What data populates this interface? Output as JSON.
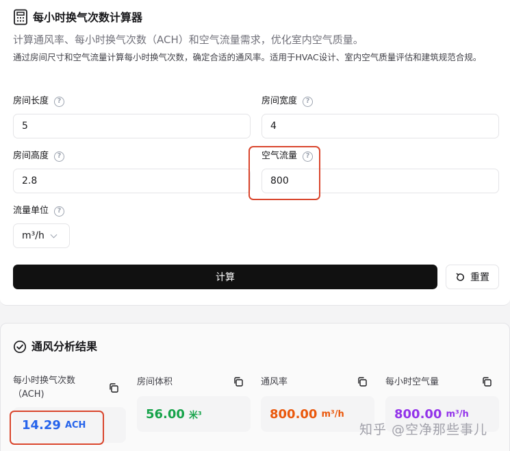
{
  "header": {
    "title": "每小时换气次数计算器",
    "subtitle": "计算通风率、每小时换气次数（ACH）和空气流量需求，优化室内空气质量。",
    "description": "通过房间尺寸和空气流量计算每小时换气次数，确定合适的通风率。适用于HVAC设计、室内空气质量评估和建筑规范合规。"
  },
  "form": {
    "length": {
      "label": "房间长度",
      "value": "5"
    },
    "width": {
      "label": "房间宽度",
      "value": "4"
    },
    "height": {
      "label": "房间高度",
      "value": "2.8"
    },
    "airflow": {
      "label": "空气流量",
      "value": "800"
    },
    "unit": {
      "label": "流量单位",
      "value": "m³/h"
    },
    "help_glyph": "?",
    "calculate_label": "计算",
    "reset_label": "重置"
  },
  "results": {
    "title": "通风分析结果",
    "items": [
      {
        "label": "每小时换气次数（ACH)",
        "value": "14.29",
        "unit": "ACH",
        "color": "#2563eb"
      },
      {
        "label": "房间体积",
        "value": "56.00",
        "unit": "米³",
        "color": "#16a34a"
      },
      {
        "label": "通风率",
        "value": "800.00",
        "unit": "m³/h",
        "color": "#ea580c"
      },
      {
        "label": "每小时空气量",
        "value": "800.00",
        "unit": "m³/h",
        "color": "#9333ea"
      }
    ]
  },
  "watermark": "知乎 @空净那些事儿",
  "colors": {
    "highlight": "#d9442b",
    "button_dark": "#111111"
  }
}
